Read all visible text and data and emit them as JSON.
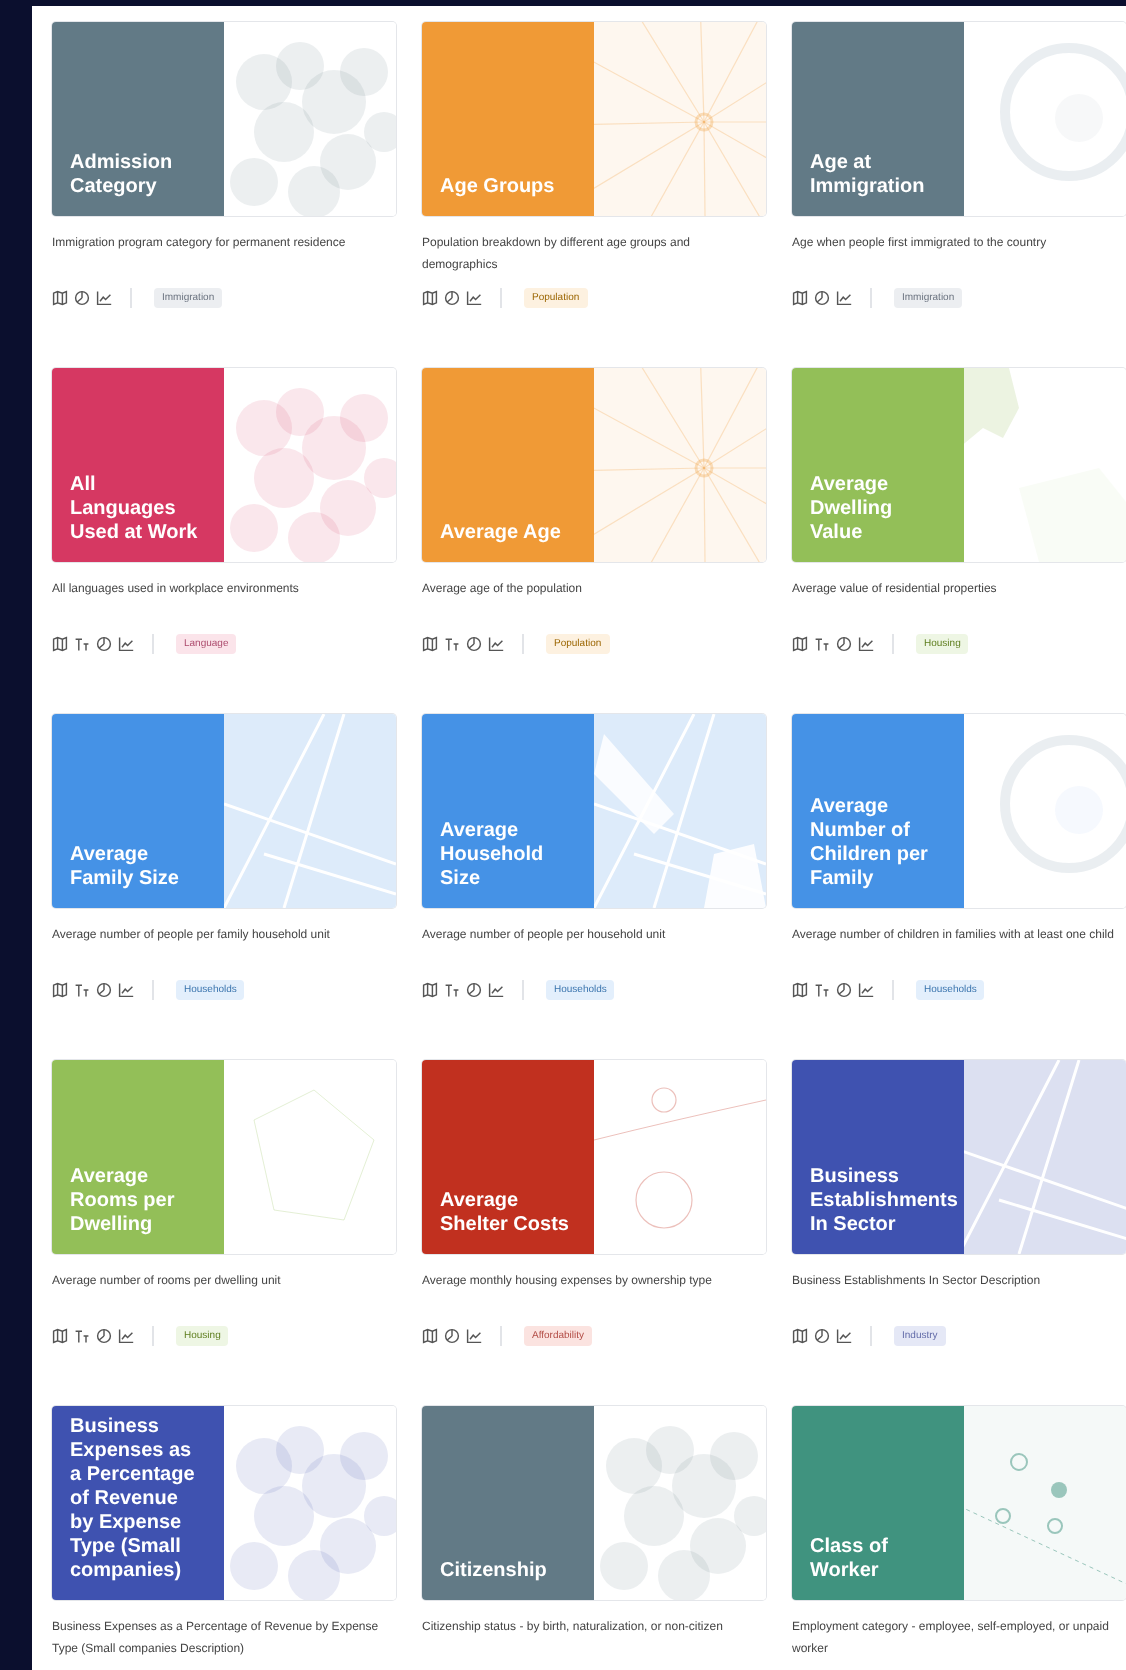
{
  "cards": [
    {
      "title": "Admission Category",
      "color": "#627a86",
      "description": "Immigration program category for permanent residence",
      "text_size_icon": false,
      "tag": {
        "label": "Immigration",
        "color": "#eceef1"
      }
    },
    {
      "title": "Age Groups",
      "color": "#f09a36",
      "description": "Population breakdown by different age groups and demographics",
      "text_size_icon": false,
      "tag": {
        "label": "Population",
        "color": "#fdf1e0"
      }
    },
    {
      "title": "Age at Immigration",
      "color": "#627a86",
      "description": "Age when people first immigrated to the country",
      "text_size_icon": false,
      "tag": {
        "label": "Immigration",
        "color": "#eceef1"
      }
    },
    {
      "title": "All Languages Used at Work",
      "color": "#d63862",
      "description": "All languages used in workplace environments",
      "text_size_icon": true,
      "tag": {
        "label": "Language",
        "color": "#fbe4ea"
      }
    },
    {
      "title": "Average Age",
      "color": "#f09a36",
      "description": "Average age of the population",
      "text_size_icon": true,
      "tag": {
        "label": "Population",
        "color": "#fdf1e0"
      }
    },
    {
      "title": "Average Dwelling Value",
      "color": "#93bf58",
      "description": "Average value of residential properties",
      "text_size_icon": true,
      "tag": {
        "label": "Housing",
        "color": "#eef6e4"
      }
    },
    {
      "title": "Average Family Size",
      "color": "#4592e6",
      "description": "Average number of people per family household unit",
      "text_size_icon": true,
      "tag": {
        "label": "Households",
        "color": "#e3effc"
      }
    },
    {
      "title": "Average Household Size",
      "color": "#4592e6",
      "description": "Average number of people per household unit",
      "text_size_icon": true,
      "tag": {
        "label": "Households",
        "color": "#e3effc"
      }
    },
    {
      "title": "Average Number of Children per Family",
      "color": "#4592e6",
      "description": "Average number of children in families with at least one child",
      "text_size_icon": true,
      "tag": {
        "label": "Households",
        "color": "#e3effc"
      }
    },
    {
      "title": "Average Rooms per Dwelling",
      "color": "#93bf58",
      "description": "Average number of rooms per dwelling unit",
      "text_size_icon": true,
      "tag": {
        "label": "Housing",
        "color": "#eef6e4"
      }
    },
    {
      "title": "Average Shelter Costs",
      "color": "#c1301f",
      "description": "Average monthly housing expenses by ownership type",
      "text_size_icon": false,
      "tag": {
        "label": "Affordability",
        "color": "#fbe3e0"
      }
    },
    {
      "title": "Business Establishments In Sector",
      "color": "#3f52b0",
      "description": "Business Establishments In Sector Description",
      "text_size_icon": false,
      "tag": {
        "label": "Industry",
        "color": "#e5e8f6"
      }
    },
    {
      "title": "Business Expenses as a Percentage of Revenue by Expense Type (Small companies)",
      "color": "#3f52b0",
      "description": "Business Expenses as a Percentage of Revenue by Expense Type (Small companies Description)"
    },
    {
      "title": "Citizenship",
      "color": "#627a86",
      "description": "Citizenship status - by birth, naturalization, or non-citizen"
    },
    {
      "title": "Class of Worker",
      "color": "#40937f",
      "description": "Employment category - employee, self-employed, or unpaid worker"
    }
  ]
}
